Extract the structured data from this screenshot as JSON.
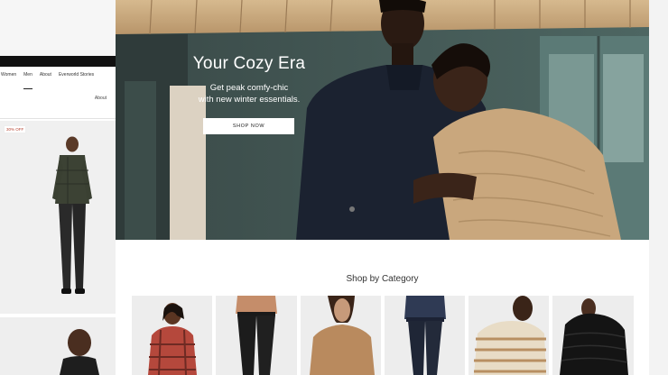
{
  "mobile": {
    "nav": [
      "Women",
      "Men",
      "About",
      "Everworld Stories"
    ],
    "active_nav": "Men",
    "about_link": "About",
    "sale_badge": "30% OFF"
  },
  "hero": {
    "title": "Your Cozy Era",
    "subtitle_line1": "Get peak comfy-chic",
    "subtitle_line2": "with new winter essentials.",
    "button_label": "SHOP NOW"
  },
  "categories": {
    "heading": "Shop by Category",
    "items": [
      {
        "name": "plaid-shirt"
      },
      {
        "name": "black-jeans"
      },
      {
        "name": "tan-tee"
      },
      {
        "name": "navy-trousers"
      },
      {
        "name": "striped-sweater"
      },
      {
        "name": "puffer-jacket"
      }
    ]
  },
  "colors": {
    "hero_dark": "#2e3a3a",
    "badge_red": "#b5412f",
    "button_bg": "#ffffff"
  }
}
